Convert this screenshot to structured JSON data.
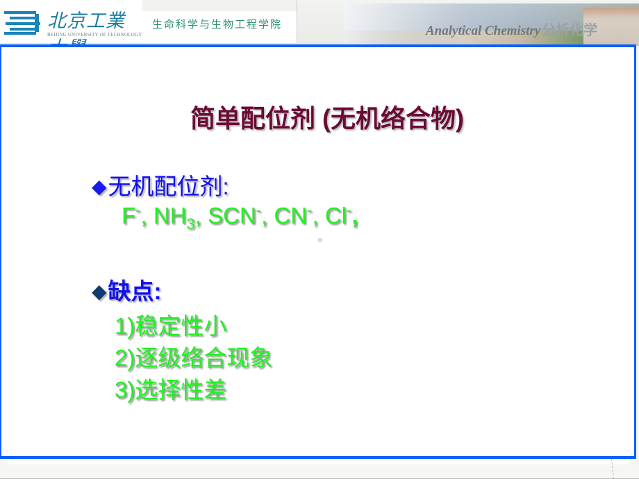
{
  "header": {
    "university_name_cn": "北京工業大學",
    "university_name_en": "BEIJING UNIVERSITY OF TECHNOLOGY",
    "school_name": "生命科学与生物工程学院",
    "course_title_en": "Analytical Chemistry",
    "course_title_cn": "分析化学",
    "logo_icon": "bjut-logo-icon"
  },
  "slide": {
    "title": "简单配位剂 (无机络合物)",
    "bullets": [
      {
        "icon": "diamond-bullet-icon",
        "color": "#1a1aef",
        "label": "无机配位剂:",
        "ions": {
          "f": "F",
          "f_charge": "-",
          "sep1": ", ",
          "nh": "NH",
          "nh_sub": "3",
          "sep2": ", ",
          "scn": "SCN",
          "scn_charge": "-",
          "sep3": ", ",
          "cn": "CN",
          "cn_charge": "-",
          "sep4": ", ",
          "cl": "Cl",
          "cl_charge": "-",
          "end": ","
        }
      },
      {
        "icon": "diamond-bullet-icon",
        "color": "#123a6b",
        "label": "缺点:",
        "items": [
          "1)稳定性小",
          "2)逐级络合现象",
          "3)选择性差"
        ]
      }
    ],
    "colors": {
      "title": "#6a0b35",
      "bullet_heading": "#1111ee",
      "detail_text": "#22f022",
      "frame_border": "#0a5fff"
    }
  }
}
